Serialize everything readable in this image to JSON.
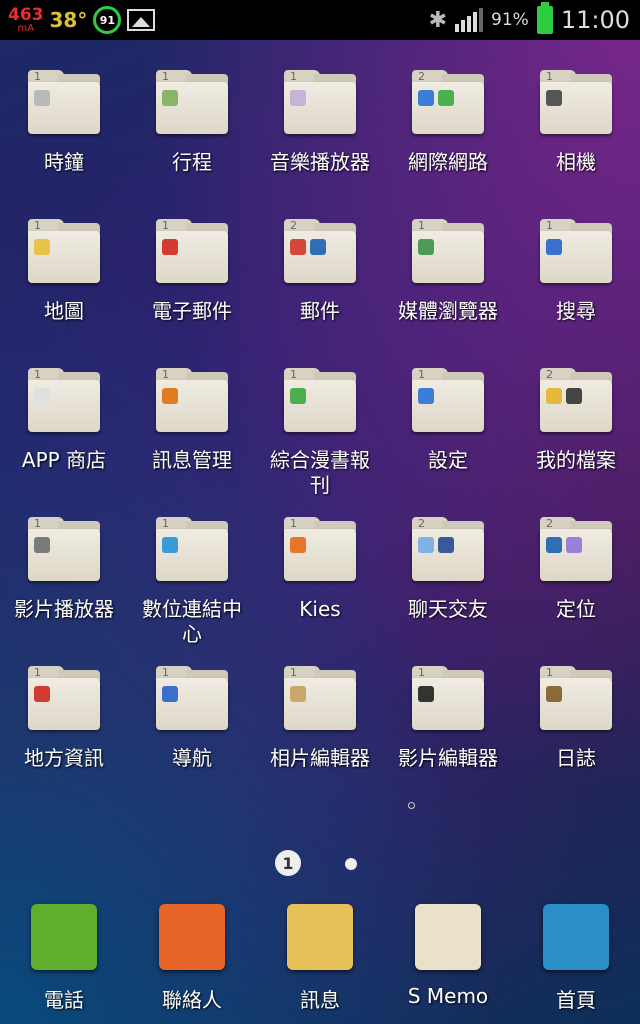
{
  "status_bar": {
    "current_ma": "463",
    "current_unit": "mA",
    "temperature": "38°",
    "battery_circle": "91",
    "battery_percent": "91%",
    "time": "11:00"
  },
  "folders": [
    {
      "label": "時鐘",
      "count": "1",
      "icons": [
        "#b9b9b9"
      ]
    },
    {
      "label": "行程",
      "count": "1",
      "icons": [
        "#8bb36a"
      ]
    },
    {
      "label": "音樂播放器",
      "count": "1",
      "icons": [
        "#c7b3d8"
      ]
    },
    {
      "label": "網際網路",
      "count": "2",
      "icons": [
        "#3b7dd8",
        "#4caf50"
      ]
    },
    {
      "label": "相機",
      "count": "1",
      "icons": [
        "#555555"
      ]
    },
    {
      "label": "地圖",
      "count": "1",
      "icons": [
        "#e8c34a"
      ]
    },
    {
      "label": "電子郵件",
      "count": "1",
      "icons": [
        "#d33b30"
      ]
    },
    {
      "label": "郵件",
      "count": "2",
      "icons": [
        "#d44638",
        "#2f6fb3"
      ]
    },
    {
      "label": "媒體瀏覽器",
      "count": "1",
      "icons": [
        "#4e9a5a"
      ]
    },
    {
      "label": "搜尋",
      "count": "1",
      "icons": [
        "#3a6fd0"
      ]
    },
    {
      "label": "APP 商店",
      "count": "1",
      "icons": [
        "#e0e0e0"
      ]
    },
    {
      "label": "訊息管理",
      "count": "1",
      "icons": [
        "#e07b22"
      ]
    },
    {
      "label": "綜合漫書報刊",
      "count": "1",
      "icons": [
        "#4cae4c"
      ]
    },
    {
      "label": "設定",
      "count": "1",
      "icons": [
        "#3b7dd8"
      ]
    },
    {
      "label": "我的檔案",
      "count": "2",
      "icons": [
        "#e8b83a",
        "#444444"
      ]
    },
    {
      "label": "影片播放器",
      "count": "1",
      "icons": [
        "#7a7a7a"
      ]
    },
    {
      "label": "數位連結中心",
      "count": "1",
      "icons": [
        "#3b9ad8"
      ]
    },
    {
      "label": "Kies",
      "count": "1",
      "icons": [
        "#e8742a"
      ]
    },
    {
      "label": "聊天交友",
      "count": "2",
      "icons": [
        "#7fb2e5",
        "#3b5998"
      ]
    },
    {
      "label": "定位",
      "count": "2",
      "icons": [
        "#2f6fb3",
        "#9b7fd8"
      ]
    },
    {
      "label": "地方資訊",
      "count": "1",
      "icons": [
        "#d33b30"
      ]
    },
    {
      "label": "導航",
      "count": "1",
      "icons": [
        "#3a6fd0"
      ]
    },
    {
      "label": "相片編輯器",
      "count": "1",
      "icons": [
        "#c9a86a"
      ]
    },
    {
      "label": "影片編輯器",
      "count": "1",
      "icons": [
        "#333333"
      ]
    },
    {
      "label": "日誌",
      "count": "1",
      "icons": [
        "#8b6a3a"
      ]
    }
  ],
  "page_indicator": {
    "current": "1"
  },
  "dock": [
    {
      "label": "電話",
      "color": "#5fae2e"
    },
    {
      "label": "聯絡人",
      "color": "#e8652a"
    },
    {
      "label": "訊息",
      "color": "#e8c05a"
    },
    {
      "label": "S Memo",
      "color": "#e9e2c8"
    },
    {
      "label": "首頁",
      "color": "#2a8fc8"
    }
  ]
}
